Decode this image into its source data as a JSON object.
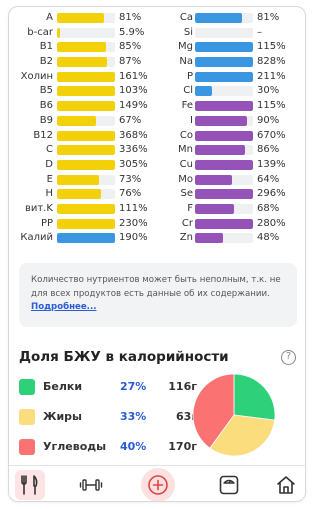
{
  "colors": {
    "yellow": "#f2d10a",
    "blue": "#3b96e2",
    "purple": "#9552b8",
    "protein": "#2ed17a",
    "fat": "#fbdd7d",
    "carbs": "#fa7272",
    "accent": "#2a5bd7"
  },
  "nutrients": {
    "left": [
      {
        "name": "A",
        "value": "81%",
        "pct": 81,
        "color": "yellow"
      },
      {
        "name": "b-car",
        "value": "5.9%",
        "pct": 5.9,
        "color": "yellow"
      },
      {
        "name": "B1",
        "value": "85%",
        "pct": 85,
        "color": "yellow"
      },
      {
        "name": "B2",
        "value": "87%",
        "pct": 87,
        "color": "yellow"
      },
      {
        "name": "Холин",
        "value": "161%",
        "pct": 161,
        "color": "yellow"
      },
      {
        "name": "B5",
        "value": "103%",
        "pct": 103,
        "color": "yellow"
      },
      {
        "name": "B6",
        "value": "149%",
        "pct": 149,
        "color": "yellow"
      },
      {
        "name": "B9",
        "value": "67%",
        "pct": 67,
        "color": "yellow"
      },
      {
        "name": "B12",
        "value": "368%",
        "pct": 368,
        "color": "yellow"
      },
      {
        "name": "C",
        "value": "336%",
        "pct": 336,
        "color": "yellow"
      },
      {
        "name": "D",
        "value": "305%",
        "pct": 305,
        "color": "yellow"
      },
      {
        "name": "E",
        "value": "73%",
        "pct": 73,
        "color": "yellow"
      },
      {
        "name": "H",
        "value": "76%",
        "pct": 76,
        "color": "yellow"
      },
      {
        "name": "вит.K",
        "value": "111%",
        "pct": 111,
        "color": "yellow"
      },
      {
        "name": "PP",
        "value": "230%",
        "pct": 230,
        "color": "yellow"
      },
      {
        "name": "Калий",
        "value": "190%",
        "pct": 190,
        "color": "blue"
      }
    ],
    "right": [
      {
        "name": "Ca",
        "value": "81%",
        "pct": 81,
        "color": "blue"
      },
      {
        "name": "Si",
        "value": "–",
        "pct": 0,
        "color": "blue"
      },
      {
        "name": "Mg",
        "value": "115%",
        "pct": 115,
        "color": "blue"
      },
      {
        "name": "Na",
        "value": "828%",
        "pct": 828,
        "color": "blue"
      },
      {
        "name": "P",
        "value": "211%",
        "pct": 211,
        "color": "blue"
      },
      {
        "name": "Cl",
        "value": "30%",
        "pct": 30,
        "color": "blue"
      },
      {
        "name": "Fe",
        "value": "115%",
        "pct": 115,
        "color": "purple"
      },
      {
        "name": "I",
        "value": "90%",
        "pct": 90,
        "color": "purple"
      },
      {
        "name": "Co",
        "value": "670%",
        "pct": 670,
        "color": "purple"
      },
      {
        "name": "Mn",
        "value": "86%",
        "pct": 86,
        "color": "purple"
      },
      {
        "name": "Cu",
        "value": "139%",
        "pct": 139,
        "color": "purple"
      },
      {
        "name": "Mo",
        "value": "64%",
        "pct": 64,
        "color": "purple"
      },
      {
        "name": "Se",
        "value": "296%",
        "pct": 296,
        "color": "purple"
      },
      {
        "name": "F",
        "value": "68%",
        "pct": 68,
        "color": "purple"
      },
      {
        "name": "Cr",
        "value": "280%",
        "pct": 280,
        "color": "purple"
      },
      {
        "name": "Zn",
        "value": "48%",
        "pct": 48,
        "color": "purple"
      }
    ]
  },
  "note": {
    "text": "Количество нутриентов может быть неполным, т.к. не для всех продуктов есть данные об их содержании.",
    "link": "Подробнее..."
  },
  "bju": {
    "title": "Доля БЖУ в калорийности",
    "rows": [
      {
        "label": "Белки",
        "pct": "27%",
        "grams": "116г",
        "share": 27,
        "color": "protein"
      },
      {
        "label": "Жиры",
        "pct": "33%",
        "grams": "63г",
        "share": 33,
        "color": "fat"
      },
      {
        "label": "Углеводы",
        "pct": "40%",
        "grams": "170г",
        "share": 40,
        "color": "carbs"
      }
    ]
  },
  "nav": {
    "items": [
      {
        "icon": "fork-knife-icon",
        "active": true
      },
      {
        "icon": "dumbbell-icon",
        "active": false
      },
      {
        "icon": "plus-icon",
        "active": false
      },
      {
        "icon": "scale-icon",
        "active": false
      },
      {
        "icon": "home-icon",
        "active": false
      }
    ]
  }
}
